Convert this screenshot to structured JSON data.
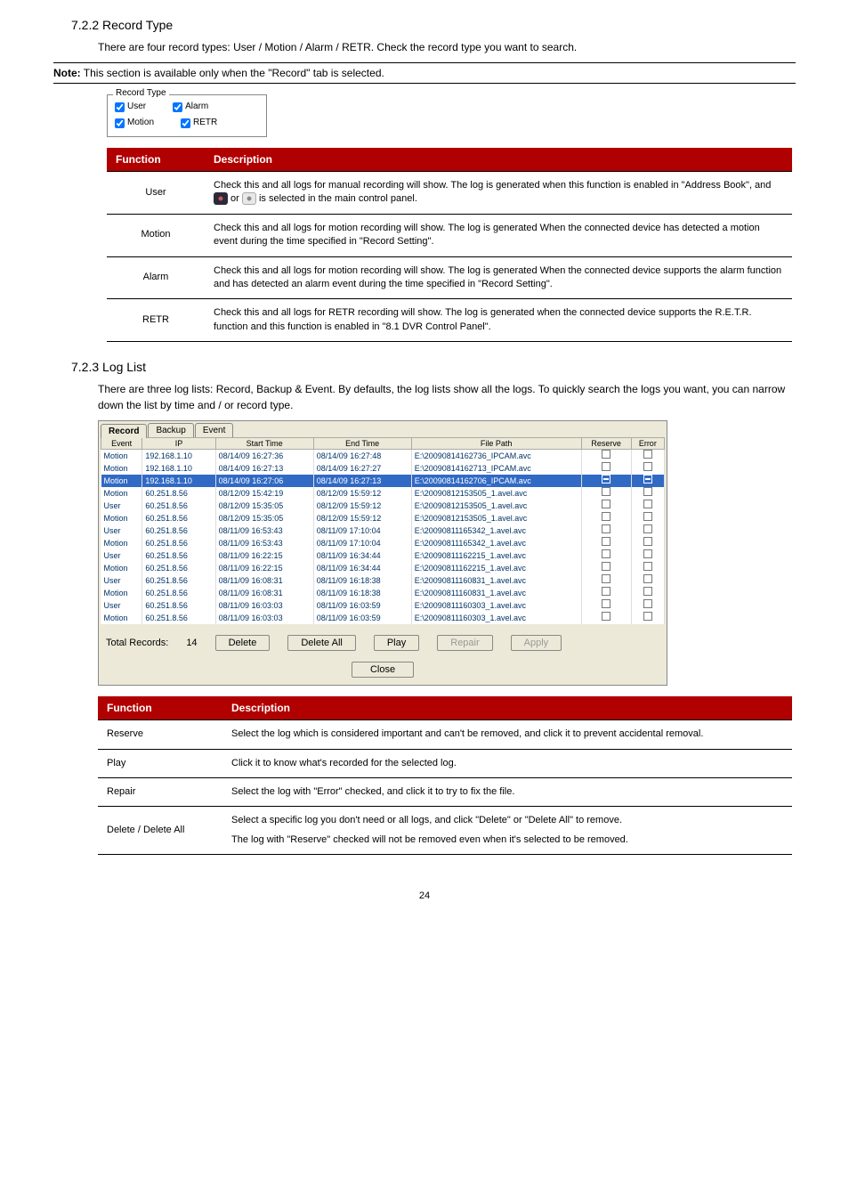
{
  "section722": {
    "title": "7.2.2 Record Type",
    "intro": "There are four record types: User / Motion / Alarm / RETR. Check the record type you want to search.",
    "note_label": "Note:",
    "note_text": "This section is available only when the \"Record\" tab is selected.",
    "box_legend": "Record Type",
    "checkboxes": {
      "user": "User",
      "alarm": "Alarm",
      "motion": "Motion",
      "retr": "RETR"
    }
  },
  "table1": {
    "headers": [
      "Function",
      "Description"
    ],
    "rows": [
      {
        "fn": "User",
        "desc_before": "Check this and all logs for manual recording will show. The log is generated when this function is enabled in \"Address Book\", and ",
        "desc_or": " or ",
        "desc_after": " is selected in the main control panel."
      },
      {
        "fn": "Motion",
        "desc": "Check this and all logs for motion recording will show. The log is generated When the connected device has detected a motion event during the time specified in \"Record Setting\"."
      },
      {
        "fn": "Alarm",
        "desc": "Check this and all logs for motion recording will show. The log is generated When the connected device supports the alarm function and has detected an alarm event during the time specified in \"Record Setting\"."
      },
      {
        "fn": "RETR",
        "desc": "Check this and all logs for RETR recording will show. The log is generated when the connected device supports the R.E.T.R. function and this function is enabled in \"8.1 DVR Control Panel\"."
      }
    ]
  },
  "section723": {
    "title": "7.2.3 Log List",
    "intro": "There are three log lists: Record, Backup & Event. By defaults, the log lists show all the logs. To quickly search the logs you want, you can narrow down the list by time and / or record type."
  },
  "logpanel": {
    "tabs": [
      "Record",
      "Backup",
      "Event"
    ],
    "headers": [
      "Event",
      "IP",
      "Start Time",
      "End Time",
      "File Path",
      "Reserve",
      "Error"
    ],
    "rows": [
      {
        "e": "Motion",
        "ip": "192.168.1.10",
        "st": "08/14/09 16:27:36",
        "et": "08/14/09 16:27:48",
        "fp": "E:\\20090814162736_IPCAM.avc",
        "sel": false
      },
      {
        "e": "Motion",
        "ip": "192.168.1.10",
        "st": "08/14/09 16:27:13",
        "et": "08/14/09 16:27:27",
        "fp": "E:\\20090814162713_IPCAM.avc",
        "sel": false
      },
      {
        "e": "Motion",
        "ip": "192.168.1.10",
        "st": "08/14/09 16:27:06",
        "et": "08/14/09 16:27:13",
        "fp": "E:\\20090814162706_IPCAM.avc",
        "sel": true
      },
      {
        "e": "Motion",
        "ip": "60.251.8.56",
        "st": "08/12/09 15:42:19",
        "et": "08/12/09 15:59:12",
        "fp": "E:\\20090812153505_1.avel.avc",
        "sel": false
      },
      {
        "e": "User",
        "ip": "60.251.8.56",
        "st": "08/12/09 15:35:05",
        "et": "08/12/09 15:59:12",
        "fp": "E:\\20090812153505_1.avel.avc",
        "sel": false
      },
      {
        "e": "Motion",
        "ip": "60.251.8.56",
        "st": "08/12/09 15:35:05",
        "et": "08/12/09 15:59:12",
        "fp": "E:\\20090812153505_1.avel.avc",
        "sel": false
      },
      {
        "e": "User",
        "ip": "60.251.8.56",
        "st": "08/11/09 16:53:43",
        "et": "08/11/09 17:10:04",
        "fp": "E:\\20090811165342_1.avel.avc",
        "sel": false
      },
      {
        "e": "Motion",
        "ip": "60.251.8.56",
        "st": "08/11/09 16:53:43",
        "et": "08/11/09 17:10:04",
        "fp": "E:\\20090811165342_1.avel.avc",
        "sel": false
      },
      {
        "e": "User",
        "ip": "60.251.8.56",
        "st": "08/11/09 16:22:15",
        "et": "08/11/09 16:34:44",
        "fp": "E:\\20090811162215_1.avel.avc",
        "sel": false
      },
      {
        "e": "Motion",
        "ip": "60.251.8.56",
        "st": "08/11/09 16:22:15",
        "et": "08/11/09 16:34:44",
        "fp": "E:\\20090811162215_1.avel.avc",
        "sel": false
      },
      {
        "e": "User",
        "ip": "60.251.8.56",
        "st": "08/11/09 16:08:31",
        "et": "08/11/09 16:18:38",
        "fp": "E:\\20090811160831_1.avel.avc",
        "sel": false
      },
      {
        "e": "Motion",
        "ip": "60.251.8.56",
        "st": "08/11/09 16:08:31",
        "et": "08/11/09 16:18:38",
        "fp": "E:\\20090811160831_1.avel.avc",
        "sel": false
      },
      {
        "e": "User",
        "ip": "60.251.8.56",
        "st": "08/11/09 16:03:03",
        "et": "08/11/09 16:03:59",
        "fp": "E:\\20090811160303_1.avel.avc",
        "sel": false
      },
      {
        "e": "Motion",
        "ip": "60.251.8.56",
        "st": "08/11/09 16:03:03",
        "et": "08/11/09 16:03:59",
        "fp": "E:\\20090811160303_1.avel.avc",
        "sel": false
      }
    ],
    "total_label": "Total Records:",
    "total_count": "14",
    "buttons": {
      "delete": "Delete",
      "delete_all": "Delete All",
      "play": "Play",
      "repair": "Repair",
      "apply": "Apply",
      "close": "Close"
    }
  },
  "table2": {
    "headers": [
      "Function",
      "Description"
    ],
    "rows": [
      {
        "fn": "Reserve",
        "desc": "Select the log which is considered important and can't be removed, and click it to prevent accidental removal."
      },
      {
        "fn": "Play",
        "desc": "Click it to know what's recorded for the selected log."
      },
      {
        "fn": "Repair",
        "desc": "Select the log with \"Error\" checked, and click it to try to fix the file."
      },
      {
        "fn": "Delete / Delete All",
        "desc": "Select a specific log you don't need or all logs, and click \"Delete\" or \"Delete All\" to remove.",
        "desc2": "The log with \"Reserve\" checked will not be removed even when it's selected to be removed."
      }
    ]
  },
  "page_number": "24"
}
